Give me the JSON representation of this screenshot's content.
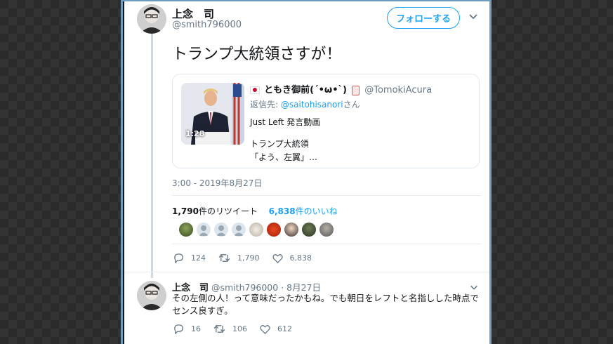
{
  "tweet": {
    "author_name": "上念　司",
    "author_handle": "@smith796000",
    "follow_label": "フォローする",
    "text": "トランプ大統領さすが！",
    "quote": {
      "author_name": "ともき御前(ˊ•ω•ˋ)",
      "author_handle": "@TomokiAcura",
      "reply_prefix": "返信先:",
      "reply_to": "@saitohisanori",
      "reply_suffix": "さん",
      "line1": "Just Left 発言動画",
      "line2": "トランプ大統領",
      "line3": "「よう、左翼」…",
      "video_duration": "1:28"
    },
    "timestamp": "3:00 - 2019年8月27日",
    "retweet_count": "1,790",
    "retweet_label": "件のリツイート",
    "like_count": "6,838",
    "like_label": "件のいいね",
    "actions": {
      "replies": "124",
      "retweets": "1,790",
      "likes": "6,838"
    }
  },
  "reply": {
    "author_name": "上念　司",
    "author_handle": "@smith796000",
    "date": "· 8月27日",
    "text": "その左側の人！って意味だったかもね。でも朝日をレフトと名指しした時点でセンス良すぎ。",
    "actions": {
      "replies": "16",
      "retweets": "106",
      "likes": "612"
    }
  },
  "icons": [
    "chevron-down-icon",
    "reply-icon",
    "retweet-icon",
    "like-icon"
  ],
  "colors": {
    "accent": "#1da1f2",
    "muted": "#657786",
    "thread_line": "#c8dae6",
    "frame": "#6d9cbd"
  }
}
